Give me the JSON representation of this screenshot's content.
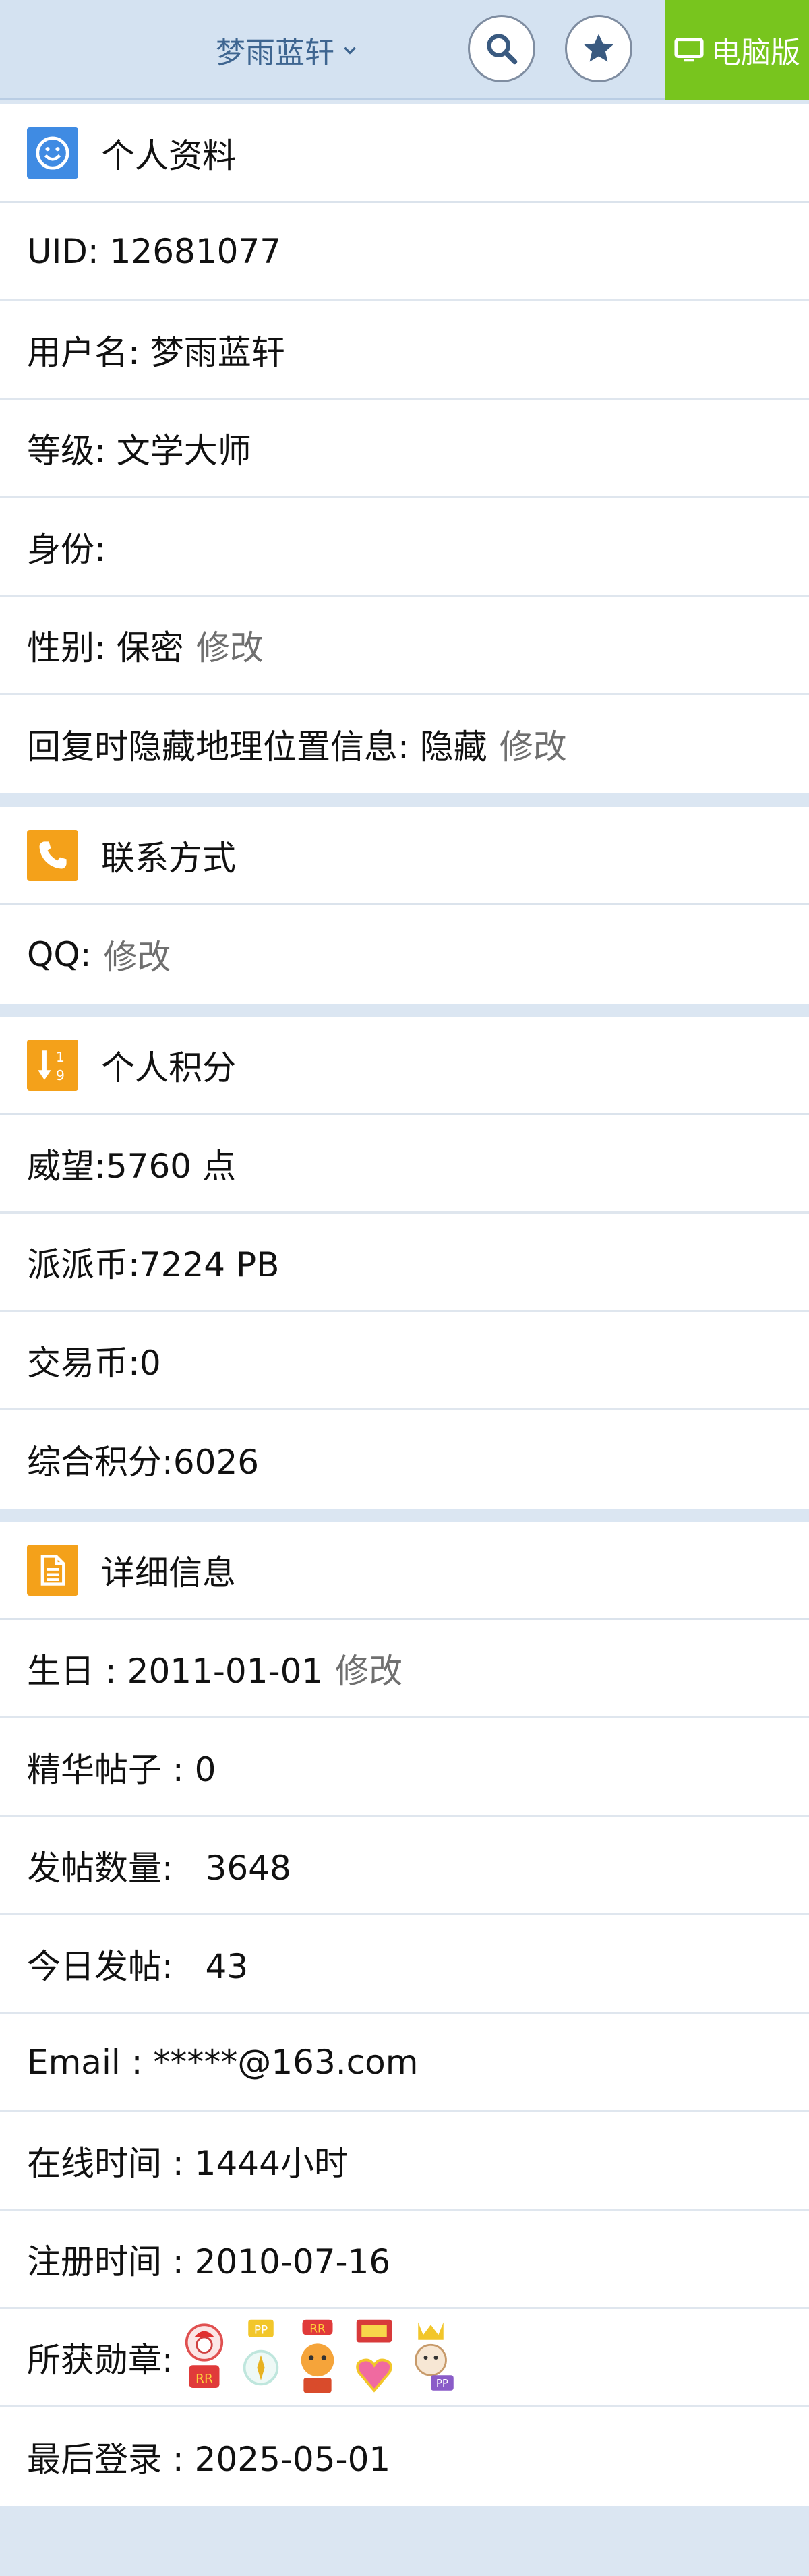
{
  "header": {
    "title": "梦雨蓝轩",
    "pc_label": "电脑版"
  },
  "colors": {
    "accent_green": "#78c51e",
    "icon_blue": "#3f8be3",
    "icon_orange": "#f4a11a",
    "header_bg": "#d4e2f1",
    "header_text": "#3e6590"
  },
  "profile": {
    "title": "个人资料",
    "icon": "smiley-icon",
    "uid": "UID: 12681077",
    "username": "用户名: 梦雨蓝轩",
    "level": "等级: 文学大师",
    "identity": "身份:",
    "gender": "性别: 保密",
    "gender_edit": "修改",
    "hide_location": "回复时隐藏地理位置信息: 隐藏",
    "hide_location_edit": "修改"
  },
  "contact": {
    "title": "联系方式",
    "icon": "phone-icon",
    "qq": "QQ:",
    "qq_edit": "修改"
  },
  "points": {
    "title": "个人积分",
    "icon": "sort-numeric-icon",
    "prestige": "威望:5760 点",
    "paipai": "派派币:7224 PB",
    "trade": "交易币:0",
    "total": "综合积分:6026"
  },
  "details": {
    "title": "详细信息",
    "icon": "document-icon",
    "birthday": "生日 : 2011-01-01",
    "birthday_edit": "修改",
    "digest_posts": "精华帖子 : 0",
    "post_count": "发帖数量:   3648",
    "today_posts": "今日发帖:   43",
    "email": "Email : *****@163.com",
    "online_time": "在线时间 : 1444小时",
    "register_time": "注册时间 : 2010-07-16",
    "medals_label": "所获勋章:",
    "medal_badges": [
      "RR",
      "PP",
      "RR",
      "",
      "PP"
    ],
    "last_login": "最后登录 : 2025-05-01"
  }
}
